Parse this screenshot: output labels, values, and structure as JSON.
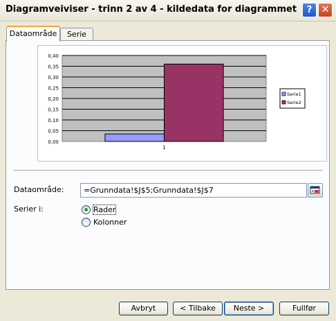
{
  "window": {
    "title": "Diagramveiviser - trinn 2 av 4 - kildedata for diagrammet",
    "help_glyph": "?",
    "close_glyph": "✕"
  },
  "tabs": [
    {
      "label": "Dataområde",
      "active": true
    },
    {
      "label": "Serie",
      "active": false
    }
  ],
  "chart_data": {
    "type": "bar",
    "categories": [
      "1"
    ],
    "series": [
      {
        "name": "Serie1",
        "values": [
          0.035
        ],
        "color": "#9999ff"
      },
      {
        "name": "Serie2",
        "values": [
          0.36
        ],
        "color": "#993366"
      }
    ],
    "y_ticks": [
      "0,00",
      "0,05",
      "0,10",
      "0,15",
      "0,20",
      "0,25",
      "0,30",
      "0,35",
      "0,40"
    ],
    "ylim": [
      0,
      0.4
    ],
    "grid": true,
    "plot_background": "#c0c0c0",
    "legend_position": "right"
  },
  "form": {
    "range_label": "Dataområde:",
    "range_value": "=Grunndata!$J$5;Grunndata!$J$7",
    "series_label": "Serier i:",
    "options": [
      {
        "label": "Rader",
        "selected": true
      },
      {
        "label": "Kolonner",
        "selected": false
      }
    ]
  },
  "buttons": {
    "cancel": "Avbryt",
    "back": "< Tilbake",
    "next": "Neste >",
    "finish": "Fullfør"
  }
}
